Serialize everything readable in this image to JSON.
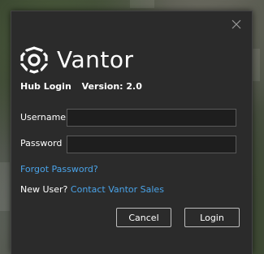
{
  "dialog": {
    "close_icon": "close-icon",
    "brand": {
      "logo_icon": "vantor-logo-icon",
      "name": "Vantor"
    },
    "title": "Hub Login",
    "version": "Version: 2.0"
  },
  "form": {
    "username_label": "Username",
    "username_value": "",
    "password_label": "Password",
    "password_value": "",
    "forgot_password": "Forgot Password?",
    "new_user_prefix": "New User?",
    "contact_sales": "Contact Vantor Sales"
  },
  "buttons": {
    "cancel": "Cancel",
    "login": "Login"
  },
  "colors": {
    "dialog_bg": "#2b2b2b",
    "input_bg": "#1e1e1e",
    "link": "#4aa3e8",
    "text": "#ffffff"
  }
}
